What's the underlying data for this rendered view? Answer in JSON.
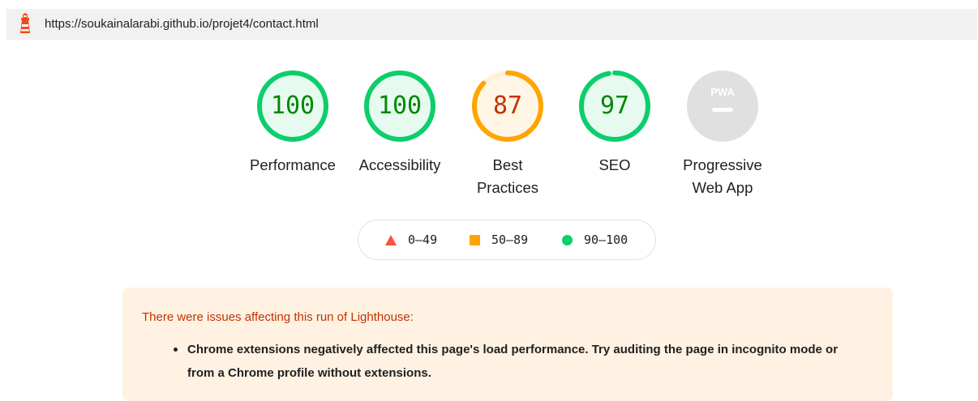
{
  "url_bar": {
    "url": "https://soukainalarabi.github.io/projet4/contact.html"
  },
  "gauges": [
    {
      "label": "Performance",
      "score": "100",
      "fraction": 1.0,
      "color": "#0cce6b",
      "text_color": "#008800"
    },
    {
      "label": "Accessibility",
      "score": "100",
      "fraction": 1.0,
      "color": "#0cce6b",
      "text_color": "#008800"
    },
    {
      "label": "Best\nPractices",
      "score": "87",
      "fraction": 0.87,
      "color": "#ffa400",
      "text_color": "#c33300"
    },
    {
      "label": "SEO",
      "score": "97",
      "fraction": 0.97,
      "color": "#0cce6b",
      "text_color": "#008800"
    },
    {
      "label": "Progressive\nWeb App",
      "badge": "PWA",
      "color": "#e0e0e0"
    }
  ],
  "legend": {
    "fail": {
      "range": "0–49",
      "color": "#ff4e42"
    },
    "average": {
      "range": "50–89",
      "color": "#ffa400"
    },
    "pass": {
      "range": "90–100",
      "color": "#0cce6b"
    }
  },
  "warning": {
    "title": "There were issues affecting this run of Lighthouse:",
    "items": [
      "Chrome extensions negatively affected this page's load performance. Try auditing the page in incognito mode or from a Chrome profile without extensions."
    ]
  }
}
